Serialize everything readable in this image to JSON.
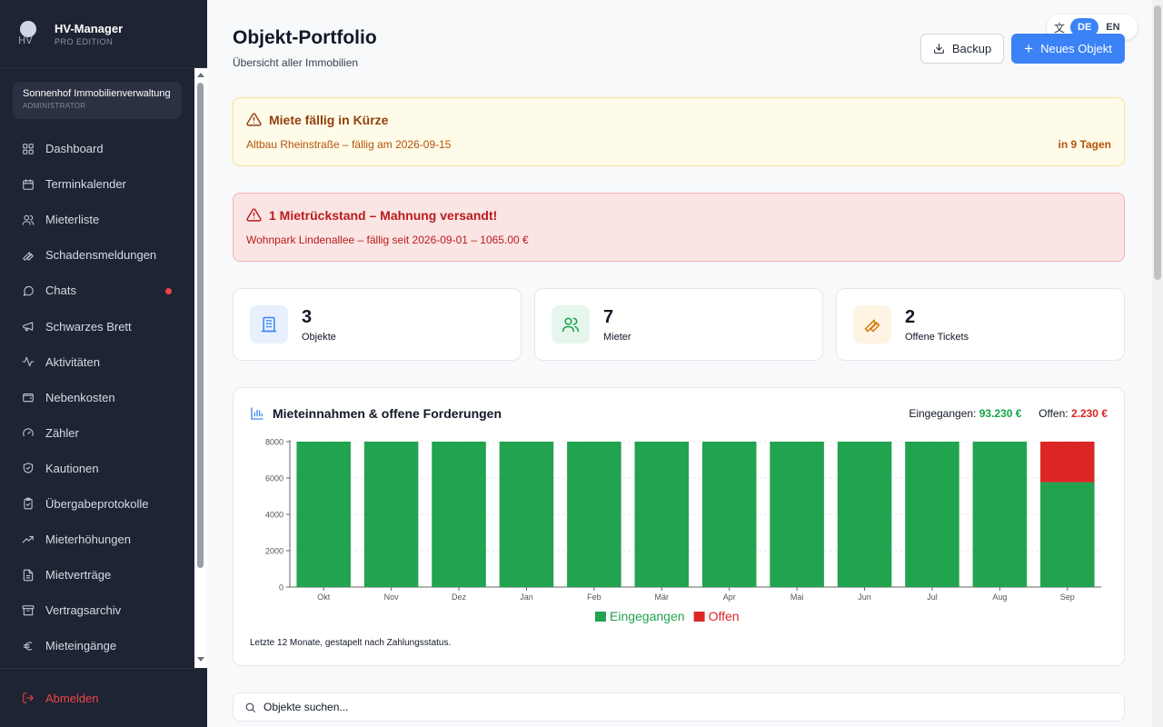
{
  "brand": {
    "logo_text": "HV",
    "title": "HV-Manager",
    "subtitle": "PRO EDITION"
  },
  "org": {
    "name": "Sonnenhof Immobilienverwaltung",
    "role": "ADMINISTRATOR"
  },
  "sidebar": {
    "items": [
      {
        "label": "Dashboard",
        "icon": "grid-icon"
      },
      {
        "label": "Terminkalender",
        "icon": "calendar-icon"
      },
      {
        "label": "Mieterliste",
        "icon": "users-icon"
      },
      {
        "label": "Schadensmeldungen",
        "icon": "wrench-icon"
      },
      {
        "label": "Chats",
        "icon": "chat-icon",
        "unread": true
      },
      {
        "label": "Schwarzes Brett",
        "icon": "megaphone-icon"
      },
      {
        "label": "Aktivitäten",
        "icon": "activity-icon"
      },
      {
        "label": "Nebenkosten",
        "icon": "wallet-icon"
      },
      {
        "label": "Zähler",
        "icon": "gauge-icon"
      },
      {
        "label": "Kautionen",
        "icon": "shield-icon"
      },
      {
        "label": "Übergabeprotokolle",
        "icon": "clipboard-icon"
      },
      {
        "label": "Mieterhöhungen",
        "icon": "trending-up-icon"
      },
      {
        "label": "Mietverträge",
        "icon": "file-icon"
      },
      {
        "label": "Vertragsarchiv",
        "icon": "archive-icon"
      },
      {
        "label": "Mieteingänge",
        "icon": "euro-icon"
      }
    ],
    "logout_label": "Abmelden"
  },
  "language": {
    "active": "DE",
    "options": [
      "DE",
      "EN"
    ]
  },
  "header": {
    "title": "Objekt-Portfolio",
    "subtitle": "Übersicht aller Immobilien",
    "backup_label": "Backup",
    "new_label": "Neues Objekt"
  },
  "alerts": {
    "rent_due": {
      "title": "Miete fällig in Kürze",
      "text": "Altbau Rheinstraße – fällig am 2026-09-15",
      "due": "in 9 Tagen"
    },
    "arrears": {
      "title": "1 Mietrückstand – Mahnung versandt!",
      "text": "Wohnpark Lindenallee – fällig seit 2026-09-01 – 1065.00 €"
    }
  },
  "stats": [
    {
      "value": "3",
      "label": "Objekte",
      "icon": "building-icon",
      "color": "#3b82f6",
      "bg": "#e8f0fd"
    },
    {
      "value": "7",
      "label": "Mieter",
      "icon": "users-icon",
      "color": "#16a34a",
      "bg": "#e7f6ec"
    },
    {
      "value": "2",
      "label": "Offene Tickets",
      "icon": "wrench-icon",
      "color": "#d97706",
      "bg": "#fdf4e3"
    }
  ],
  "chart": {
    "title": "Mieteinnahmen & offene Forderungen",
    "received_label": "Eingegangen:",
    "received_value": "93.230 €",
    "open_label": "Offen:",
    "open_value": "2.230 €",
    "footnote": "Letzte 12 Monate, gestapelt nach Zahlungsstatus."
  },
  "chart_data": {
    "type": "bar",
    "stacked": true,
    "categories": [
      "Okt",
      "Nov",
      "Dez",
      "Jan",
      "Feb",
      "Mär",
      "Apr",
      "Mai",
      "Jun",
      "Jul",
      "Aug",
      "Sep"
    ],
    "series": [
      {
        "name": "Eingegangen",
        "color": "#22a34f",
        "values": [
          8000,
          8000,
          8000,
          8000,
          8000,
          8000,
          8000,
          8000,
          8000,
          8000,
          8000,
          5770
        ]
      },
      {
        "name": "Offen",
        "color": "#dc2626",
        "values": [
          0,
          0,
          0,
          0,
          0,
          0,
          0,
          0,
          0,
          0,
          0,
          2230
        ]
      }
    ],
    "yticks": [
      0,
      2000,
      4000,
      6000,
      8000
    ],
    "ylim": [
      0,
      8000
    ],
    "legend": "bottom",
    "grid": true
  },
  "search": {
    "placeholder": "Objekte suchen..."
  }
}
